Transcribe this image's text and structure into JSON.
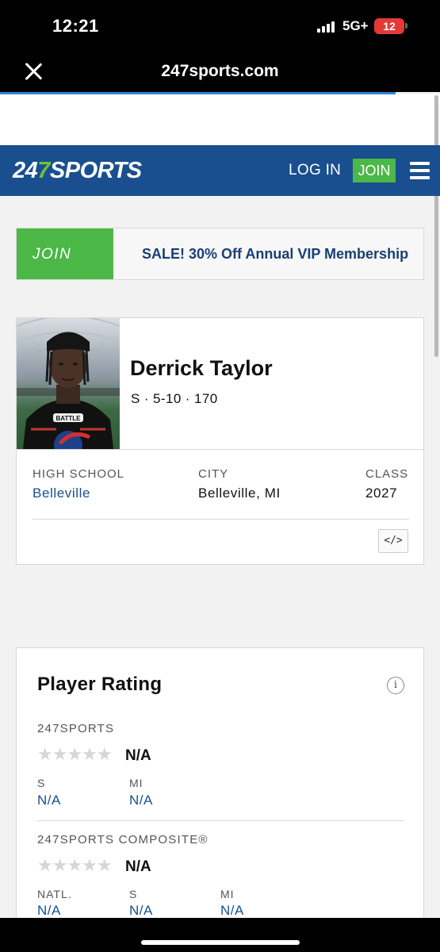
{
  "status_bar": {
    "time": "12:21",
    "network": "5G+",
    "battery": "12"
  },
  "browser": {
    "url": "247sports.com"
  },
  "header": {
    "logo_prefix": "24",
    "logo_seven": "7",
    "logo_suffix": "SPORTS",
    "login_label": "LOG IN",
    "join_label": "JOIN"
  },
  "promo": {
    "join_label": "JOIN",
    "text": "SALE! 30% Off Annual VIP Membership"
  },
  "player": {
    "name": "Derrick Taylor",
    "meta": "S · 5-10 · 170",
    "jersey_text": "BATTLE",
    "high_school_label": "HIGH SCHOOL",
    "high_school": "Belleville",
    "city_label": "CITY",
    "city": "Belleville, MI",
    "class_label": "CLASS",
    "class_year": "2027",
    "embed_icon": "</>"
  },
  "rating": {
    "title": "Player Rating",
    "info_icon": "i",
    "sports247": {
      "label": "247SPORTS",
      "stars": "★★★★★",
      "value": "N/A",
      "positions": [
        {
          "label": "S",
          "value": "N/A"
        },
        {
          "label": "MI",
          "value": "N/A"
        }
      ]
    },
    "composite": {
      "label": "247SPORTS COMPOSITE®",
      "stars": "★★★★★",
      "value": "N/A",
      "positions": [
        {
          "label": "NATL.",
          "value": "N/A"
        },
        {
          "label": "S",
          "value": "N/A"
        },
        {
          "label": "MI",
          "value": "N/A"
        }
      ]
    }
  },
  "colors": {
    "brand_blue": "#1a4f8f",
    "join_green": "#4cb847",
    "battery_red": "#e53935"
  }
}
